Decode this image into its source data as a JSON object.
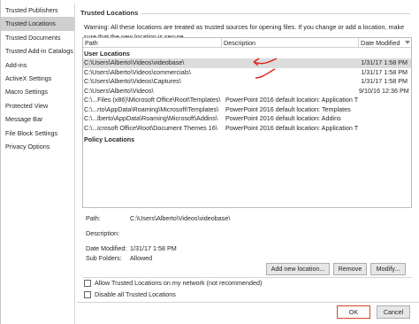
{
  "sidebar": {
    "items": [
      {
        "label": "Trusted Publishers",
        "selected": false
      },
      {
        "label": "Trusted Locations",
        "selected": true
      },
      {
        "label": "Trusted Documents",
        "selected": false
      },
      {
        "label": "Trusted Add-in Catalogs",
        "selected": false
      },
      {
        "label": "Add-ins",
        "selected": false
      },
      {
        "label": "ActiveX Settings",
        "selected": false
      },
      {
        "label": "Macro Settings",
        "selected": false
      },
      {
        "label": "Protected View",
        "selected": false
      },
      {
        "label": "Message Bar",
        "selected": false
      },
      {
        "label": "File Block Settings",
        "selected": false
      },
      {
        "label": "Privacy Options",
        "selected": false
      }
    ]
  },
  "main": {
    "title": "Trusted Locations",
    "warning": "Warning: All these locations are treated as trusted sources for opening files.  If you change or add a location, make sure that the new location is secure.",
    "table": {
      "columns": {
        "path": "Path",
        "description": "Description",
        "date": "Date Modified"
      },
      "user_group": "User Locations",
      "policy_group": "Policy Locations",
      "rows": [
        {
          "path": "C:\\Users\\Alberto\\Videos\\videobase\\",
          "description": "",
          "date": "1/31/17 1:58 PM",
          "selected": true
        },
        {
          "path": "C:\\Users\\Alberto\\Videos\\commercials\\",
          "description": "",
          "date": "1/31/17 1:58 PM",
          "selected": false
        },
        {
          "path": "C:\\Users\\Alberto\\Videos\\Captures\\",
          "description": "",
          "date": "1/31/17 1:58 PM",
          "selected": false
        },
        {
          "path": "C:\\Users\\Alberto\\Videos\\",
          "description": "",
          "date": "9/10/16 12:36 PM",
          "selected": false
        },
        {
          "path": "C:\\...Files (x86)\\Microsoft Office\\Root\\Templates\\",
          "description": "PowerPoint 2016 default location: Application T...",
          "date": "",
          "selected": false
        },
        {
          "path": "C:\\...rto\\AppData\\Roaming\\Microsoft\\Templates\\",
          "description": "PowerPoint 2016 default location: Templates",
          "date": "",
          "selected": false
        },
        {
          "path": "C:\\...lberto\\AppData\\Roaming\\Microsoft\\Addins\\",
          "description": "PowerPoint 2016 default location: Addins",
          "date": "",
          "selected": false
        },
        {
          "path": "C:\\...icrosoft Office\\Root\\Document Themes 16\\",
          "description": "PowerPoint 2016 default location: Application T...",
          "date": "",
          "selected": false
        }
      ]
    },
    "details": {
      "path_label": "Path:",
      "path_value": "C:\\Users\\Alberto\\Videos\\videobase\\",
      "description_label": "Description:",
      "date_label": "Date Modified:",
      "date_value": "1/31/17 1:58 PM",
      "subfolders_label": "Sub Folders:",
      "subfolders_value": "Allowed"
    },
    "buttons": {
      "add": "Add new location...",
      "remove": "Remove",
      "modify": "Modify..."
    },
    "checkboxes": {
      "allow_network": "Allow Trusted Locations on my network (not recommended)",
      "disable_all": "Disable all Trusted Locations"
    }
  },
  "footer": {
    "ok": "OK",
    "cancel": "Cancel"
  },
  "colors": {
    "selected_nav": "#cfcfcf",
    "annotation_red": "#e0201b",
    "ok_border": "#d24726"
  },
  "icons": {
    "sort": "chevron-down-icon",
    "annotation": "red-arrow-annotation"
  }
}
